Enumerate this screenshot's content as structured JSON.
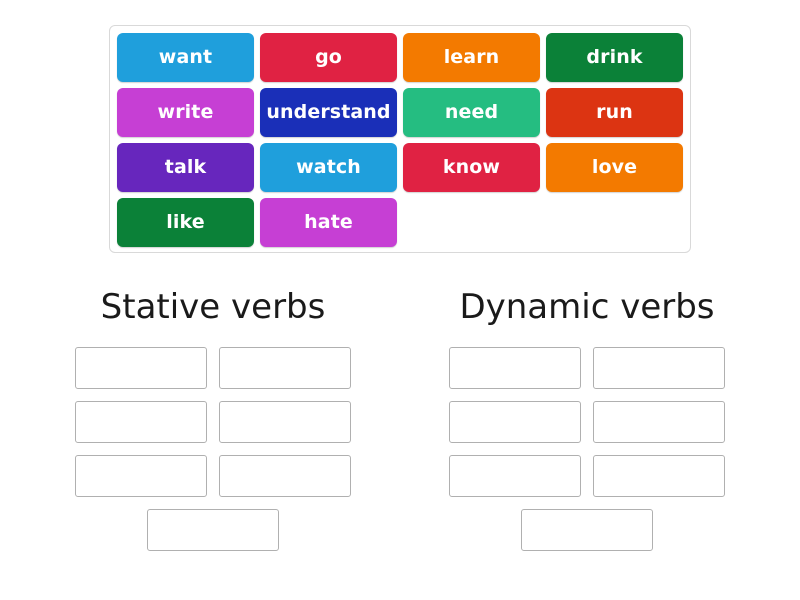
{
  "activity": {
    "type": "group-sort",
    "word_bank": {
      "tiles": [
        {
          "label": "want",
          "color": "#1f9fdc"
        },
        {
          "label": "go",
          "color": "#e02243"
        },
        {
          "label": "learn",
          "color": "#f37a00"
        },
        {
          "label": "drink",
          "color": "#0b8138"
        },
        {
          "label": "write",
          "color": "#c63fd4"
        },
        {
          "label": "understand",
          "color": "#1a2fb8"
        },
        {
          "label": "need",
          "color": "#25bd81"
        },
        {
          "label": "run",
          "color": "#dc3412"
        },
        {
          "label": "talk",
          "color": "#6726bd"
        },
        {
          "label": "watch",
          "color": "#1f9fdc"
        },
        {
          "label": "know",
          "color": "#e02243"
        },
        {
          "label": "love",
          "color": "#f37a00"
        },
        {
          "label": "like",
          "color": "#0b8138"
        },
        {
          "label": "hate",
          "color": "#c63fd4"
        }
      ]
    },
    "columns": [
      {
        "title": "Stative verbs",
        "slots": [
          {
            "value": ""
          },
          {
            "value": ""
          },
          {
            "value": ""
          },
          {
            "value": ""
          },
          {
            "value": ""
          },
          {
            "value": ""
          },
          {
            "value": ""
          }
        ]
      },
      {
        "title": "Dynamic verbs",
        "slots": [
          {
            "value": ""
          },
          {
            "value": ""
          },
          {
            "value": ""
          },
          {
            "value": ""
          },
          {
            "value": ""
          },
          {
            "value": ""
          },
          {
            "value": ""
          }
        ]
      }
    ]
  },
  "theme": {
    "page_background": "#ffffff",
    "bank_border": "#d9d9d9",
    "slot_border": "#b0b0b0",
    "title_color": "#1a1a1a",
    "tile_text_color": "#ffffff"
  }
}
